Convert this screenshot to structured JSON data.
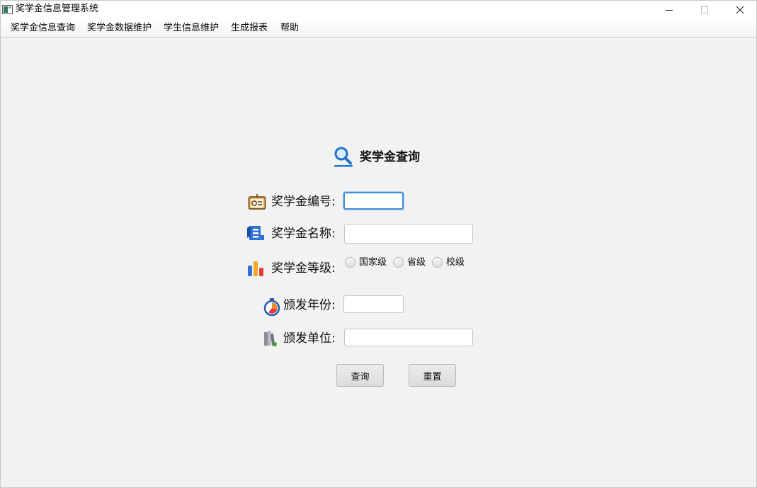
{
  "window": {
    "title": "奖学金信息管理系统",
    "controls": {
      "minimize": "—",
      "maximize": "□",
      "close": "✕"
    }
  },
  "menu": {
    "items": [
      "奖学金信息查询",
      "奖学金数据维护",
      "学生信息维护",
      "生成报表",
      "帮助"
    ]
  },
  "form": {
    "heading": "奖学金查询",
    "heading_icon": "search-icon",
    "fields": {
      "id": {
        "label": "奖学金编号:",
        "value": "",
        "icon": "id-card-icon"
      },
      "name": {
        "label": "奖学金名称:",
        "value": "",
        "icon": "scroll-icon"
      },
      "level": {
        "label": "奖学金等级:",
        "icon": "bar-chart-icon",
        "options": [
          "国家级",
          "省级",
          "校级"
        ],
        "selected": null
      },
      "year": {
        "label": "颁发年份:",
        "value": "",
        "icon": "stopwatch-icon"
      },
      "unit": {
        "label": "颁发单位:",
        "value": "",
        "icon": "books-icon"
      }
    },
    "buttons": {
      "query": "查询",
      "reset": "重置"
    }
  },
  "colors": {
    "background": "#f2f2f2",
    "focus_border": "#3e8fd6",
    "search_icon": "#1f73c9"
  }
}
